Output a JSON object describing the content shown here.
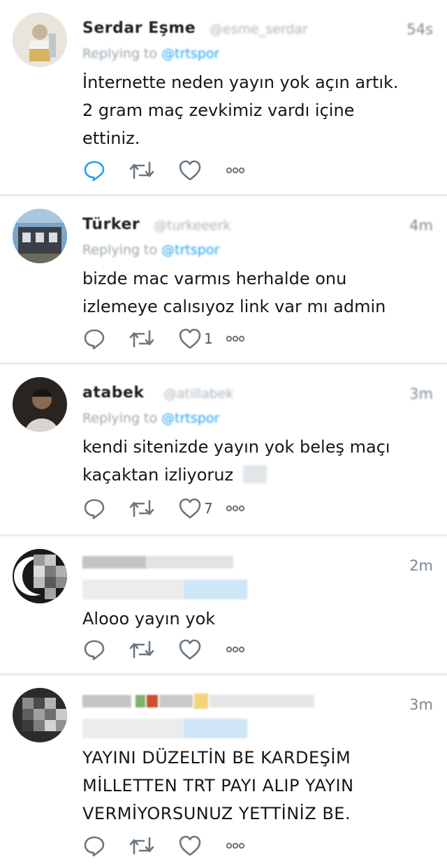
{
  "tweets": [
    {
      "name": "Serdar Eşme",
      "handle": "@esme_serdar",
      "time": "54s",
      "replying_label": "Replying to",
      "replying_to": "@trtspor",
      "lines": [
        "İnternette neden yayın yok açın artık.",
        "2 gram maç zevkimiz vardı içine",
        "ettiniz."
      ],
      "like_count": "",
      "reply_active": true
    },
    {
      "name": "Türker",
      "handle": "@turkeeerk",
      "time": "4m",
      "replying_label": "Replying to",
      "replying_to": "@trtspor",
      "lines": [
        "bizde mac varmıs herhalde onu",
        "izlemeye calısıyoz link var mı admin"
      ],
      "like_count": "1",
      "reply_active": false
    },
    {
      "name": "atabek",
      "handle": "@atillabek",
      "time": "3m",
      "replying_label": "Replying to",
      "replying_to": "@trtspor",
      "lines": [
        "kendi sitenizde yayın yok beleş maçı",
        "kaçaktan izliyoruz"
      ],
      "like_count": "7",
      "reply_active": false
    },
    {
      "time": "2m",
      "lines": [
        "Alooo yayın yok"
      ],
      "like_count": "",
      "reply_active": false
    },
    {
      "time": "3m",
      "lines": [
        "YAYINI DÜZELTİN BE KARDEŞİM",
        "MİLLETTEN TRT PAYI ALIP YAYIN",
        "VERMİYORSUNUZ YETTİNİZ BE."
      ],
      "like_count": "",
      "reply_active": false
    }
  ],
  "icons": {
    "reply": "reply-icon",
    "retweet": "retweet-icon",
    "like": "like-icon",
    "more": "more-icon"
  },
  "colors": {
    "accent": "#1da1f2",
    "icon_gray": "#6b7780",
    "separator": "#e6ecf0"
  }
}
